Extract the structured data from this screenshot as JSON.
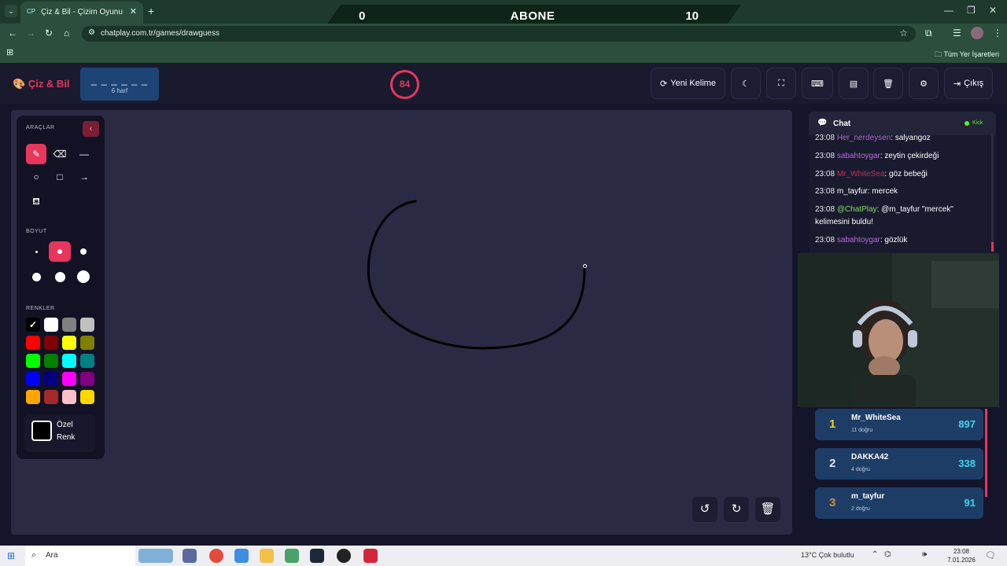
{
  "browser": {
    "tab_title": "Çiz & Bil - Çizim Oyunu",
    "tab_favicon": "CP",
    "url": "chatplay.com.tr/games/drawguess",
    "bookmarks_right": "Tüm Yer İşaretleri"
  },
  "score_banner": {
    "left": "0",
    "center": "ABONE",
    "right": "10"
  },
  "header": {
    "logo": "Çiz & Bil",
    "word_dashes": "_ _ _ _ _ _",
    "word_length": "6 harf",
    "timer": "84",
    "new_word_label": "Yeni Kelime",
    "exit_label": "Çıkış"
  },
  "tools": {
    "tools_label": "ARAÇLAR",
    "size_label": "BOYUT",
    "colors_label": "RENKLER",
    "custom_color_label": "Özel Renk",
    "colors": [
      "#000000",
      "#ffffff",
      "#808080",
      "#c0c0c0",
      "#ff0000",
      "#800000",
      "#ffff00",
      "#808000",
      "#00ff00",
      "#008000",
      "#00ffff",
      "#008080",
      "#0000ff",
      "#000080",
      "#ff00ff",
      "#800080",
      "#ffa500",
      "#a52a2a",
      "#ffc0cb",
      "#ffd700"
    ]
  },
  "chat": {
    "title": "Chat",
    "kick": "Kick",
    "messages": [
      {
        "time": "23:08",
        "user": "Her_nerdeysen",
        "user_color": "#b36bd6",
        "text": ": salyangoz"
      },
      {
        "time": "23:08",
        "user": "sabahtoygar",
        "user_color": "#b36bd6",
        "text": ": zeytin çekirdeği"
      },
      {
        "time": "23:08",
        "user": "Mr_WhiteSea",
        "user_color": "#c0305a",
        "text": ": göz bebeği"
      },
      {
        "time": "23:08",
        "user": "m_tayfur",
        "user_color": "#ffffff",
        "text": ": mercek"
      },
      {
        "time": "23:08",
        "user": "@ChatPlay",
        "user_color": "#7ddc6a",
        "text": ": @m_tayfur \"mercek\" kelimesini buldu!"
      },
      {
        "time": "23:08",
        "user": "sabahtoygar",
        "user_color": "#b36bd6",
        "text": ": gözlük"
      }
    ]
  },
  "leaderboard": [
    {
      "rank": "1",
      "rank_color": "#f5d020",
      "name": "Mr_WhiteSea",
      "sub": "11 doğru",
      "score": "897"
    },
    {
      "rank": "2",
      "rank_color": "#dfe5ee",
      "name": "DAKKA42",
      "sub": "4 doğru",
      "score": "338"
    },
    {
      "rank": "3",
      "rank_color": "#d98a3a",
      "name": "m_tayfur",
      "sub": "2 doğru",
      "score": "91"
    }
  ],
  "taskbar": {
    "search": "Ara",
    "weather": "13°C  Çok bulutlu",
    "time": "23:08",
    "date": "7.01.2026"
  }
}
